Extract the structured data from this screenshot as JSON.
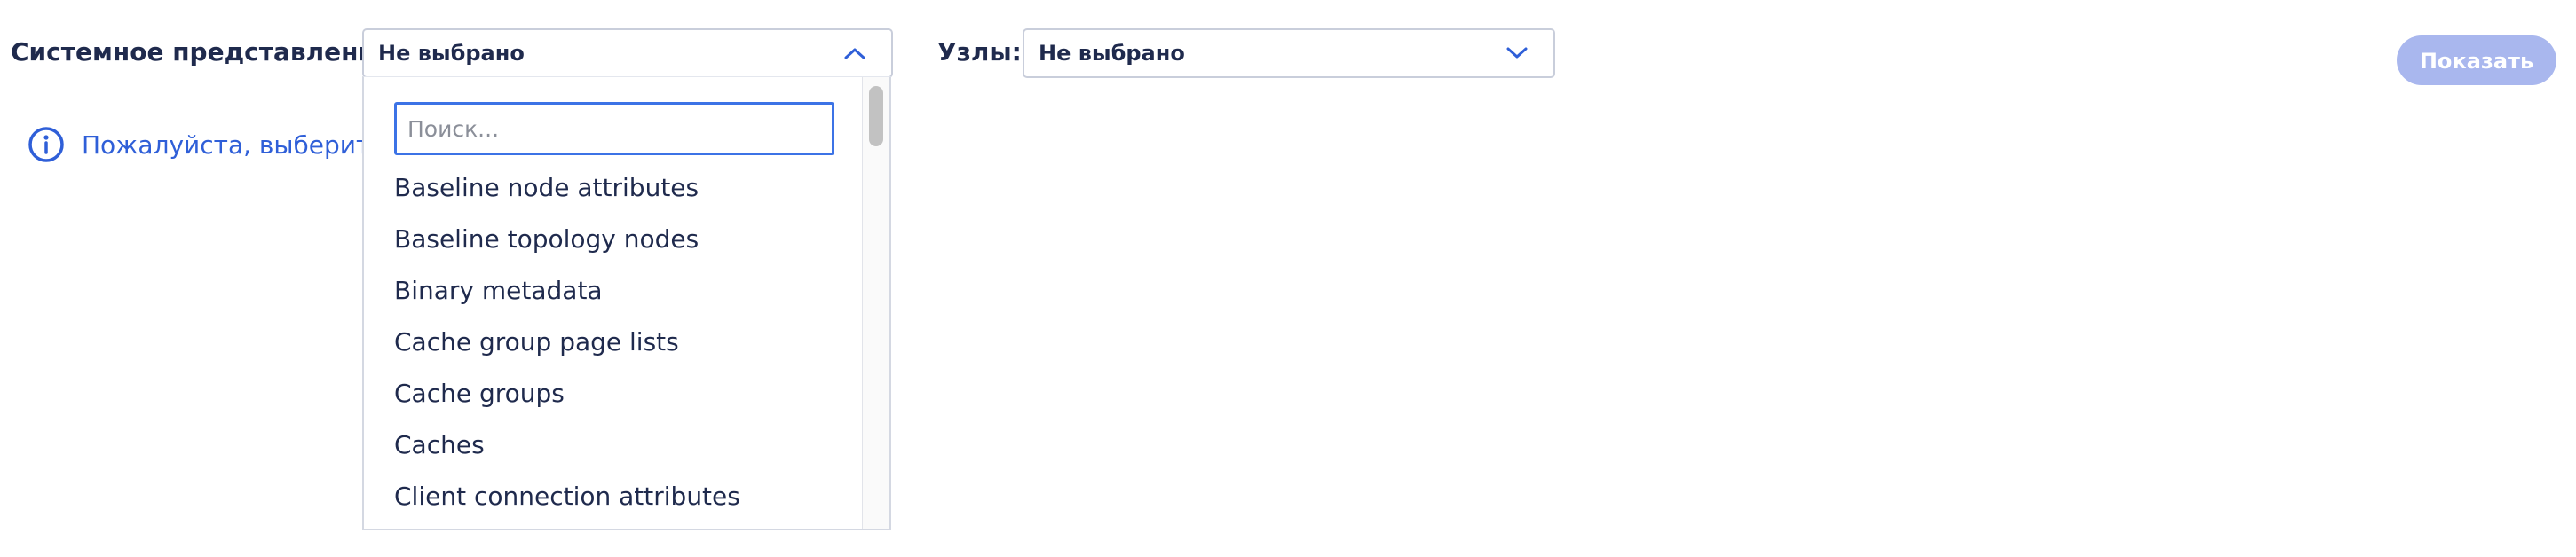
{
  "filters": {
    "system_view": {
      "label": "Системное представление:",
      "value": "Не выбрано",
      "expanded": true,
      "icon": "chevron-up-icon"
    },
    "nodes": {
      "label": "Узлы:",
      "value": "Не выбрано",
      "icon": "chevron-down-icon"
    },
    "show_button": {
      "label": "Показать",
      "disabled": true
    }
  },
  "info": {
    "icon": "info-icon",
    "message": "Пожалуйста, выберите"
  },
  "dropdown": {
    "search_placeholder": "Поиск...",
    "search_value": "",
    "options": [
      "Baseline node attributes",
      "Baseline topology nodes",
      "Binary metadata",
      "Cache group page lists",
      "Cache groups",
      "Caches",
      "Client connection attributes"
    ]
  },
  "colors": {
    "text": "#1f2a4d",
    "accent": "#2f5fd8",
    "button_disabled": "#a9b7ee",
    "focus_border": "#3c73e6",
    "field_border": "#c9cedb"
  }
}
